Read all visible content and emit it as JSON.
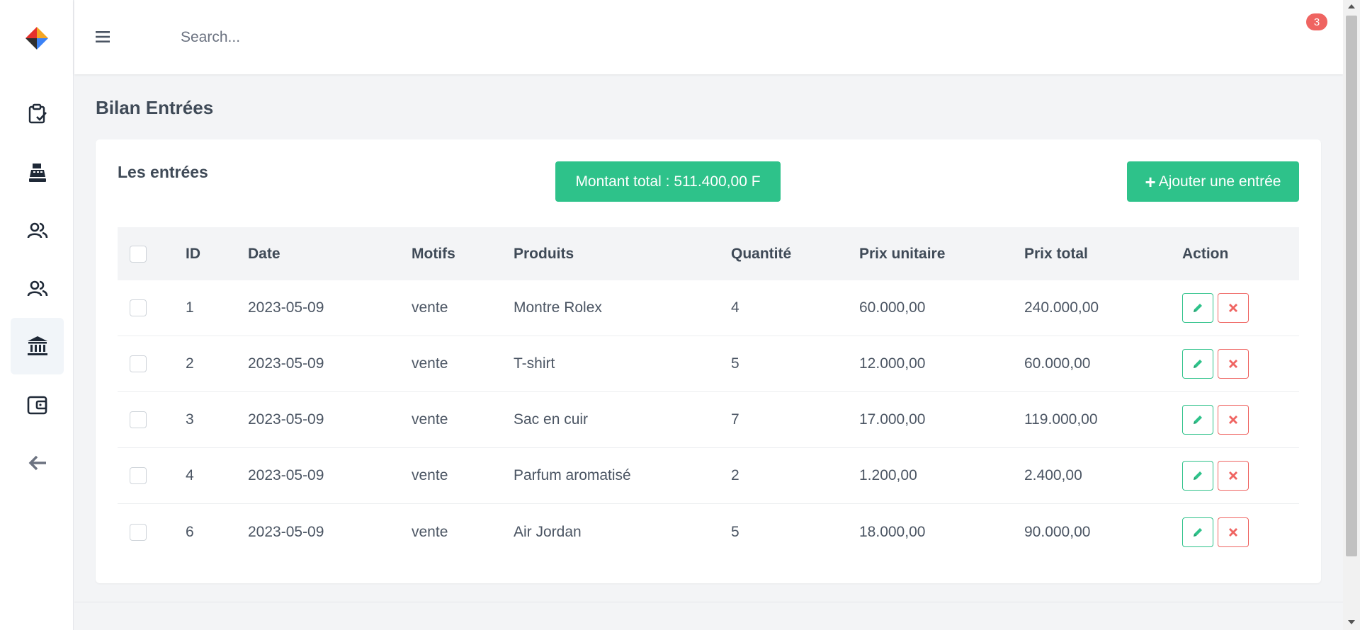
{
  "topbar": {
    "search_placeholder": "Search...",
    "notification_count": "3"
  },
  "sidebar": {
    "items": [
      {
        "icon": "clipboard-check-icon"
      },
      {
        "icon": "cash-register-icon"
      },
      {
        "icon": "users-icon"
      },
      {
        "icon": "users-icon"
      },
      {
        "icon": "bank-icon",
        "active": true
      },
      {
        "icon": "wallet-icon"
      },
      {
        "icon": "arrow-left-icon"
      }
    ]
  },
  "page": {
    "title": "Bilan Entrées"
  },
  "card": {
    "title": "Les entrées",
    "total_label": "Montant total : 511.400,00 F",
    "add_button_label": "Ajouter une entrée"
  },
  "table": {
    "columns": [
      "ID",
      "Date",
      "Motifs",
      "Produits",
      "Quantité",
      "Prix unitaire",
      "Prix total",
      "Action"
    ],
    "rows": [
      {
        "id": "1",
        "date": "2023-05-09",
        "motif": "vente",
        "produit": "Montre Rolex",
        "quantite": "4",
        "prix_unitaire": "60.000,00",
        "prix_total": "240.000,00"
      },
      {
        "id": "2",
        "date": "2023-05-09",
        "motif": "vente",
        "produit": "T-shirt",
        "quantite": "5",
        "prix_unitaire": "12.000,00",
        "prix_total": "60.000,00"
      },
      {
        "id": "3",
        "date": "2023-05-09",
        "motif": "vente",
        "produit": "Sac en cuir",
        "quantite": "7",
        "prix_unitaire": "17.000,00",
        "prix_total": "119.000,00"
      },
      {
        "id": "4",
        "date": "2023-05-09",
        "motif": "vente",
        "produit": "Parfum aromatisé",
        "quantite": "2",
        "prix_unitaire": "1.200,00",
        "prix_total": "2.400,00"
      },
      {
        "id": "6",
        "date": "2023-05-09",
        "motif": "vente",
        "produit": "Air Jordan",
        "quantite": "5",
        "prix_unitaire": "18.000,00",
        "prix_total": "90.000,00"
      }
    ]
  },
  "colors": {
    "accent_green": "#2ec28a",
    "danger_red": "#ef6461",
    "badge_red": "#ef6461"
  }
}
